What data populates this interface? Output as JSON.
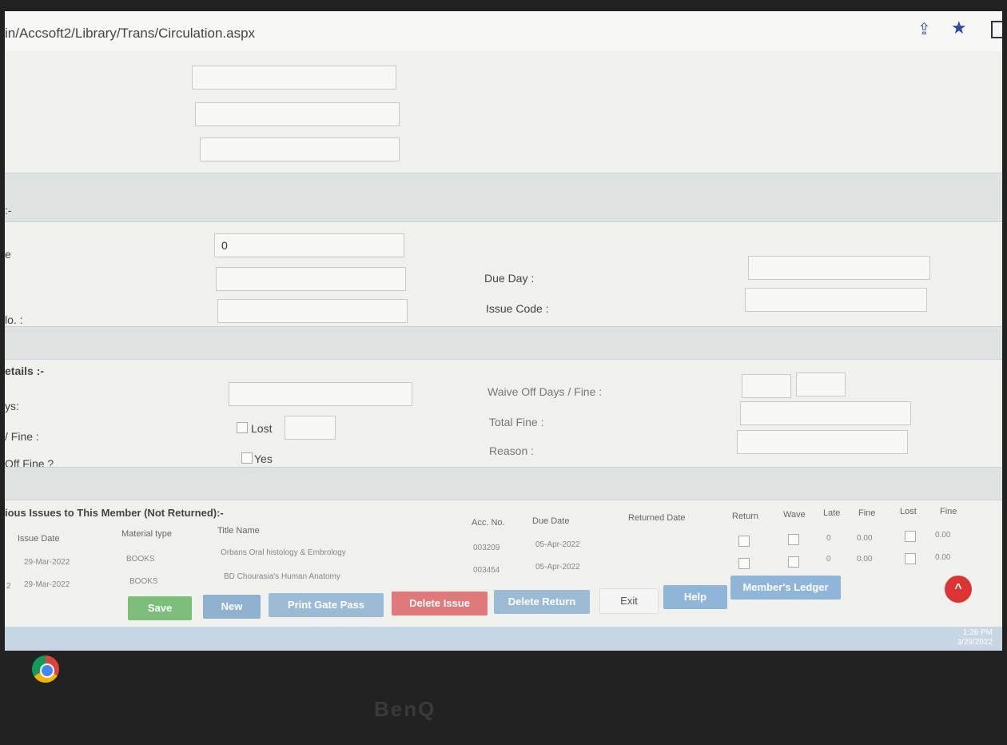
{
  "browser": {
    "url": "in/Accsoft2/Library/Trans/Circulation.aspx",
    "share_icon": "share-icon",
    "star_icon": "star-icon"
  },
  "section1": {
    "header": ":-",
    "field_a_label": "e",
    "field_a_value": "0",
    "field_c_label": "lo. :",
    "due_day_label": "Due Day :",
    "issue_code_label": "Issue Code :"
  },
  "section2": {
    "header": "etails :-",
    "row1_label": "ys:",
    "row2_label": "/ Fine :",
    "row3_label": "Off Fine ?",
    "lost_label": "Lost",
    "yes_label": "Yes",
    "waive_label": "Waive Off Days / Fine :",
    "total_fine_label": "Total Fine :",
    "reason_label": "Reason :"
  },
  "previous": {
    "title": "ious Issues to This Member (Not Returned):-",
    "headers": [
      "Issue Date",
      "Material type",
      "Title Name",
      "Acc. No.",
      "Due Date",
      "Returned Date",
      "Return",
      "Wave",
      "Late",
      "Fine",
      "Lost",
      "Fine"
    ],
    "rows": [
      {
        "num": "",
        "issue_date": "29-Mar-2022",
        "material": "BOOKS",
        "title": "Orbans Oral histology & Embrology",
        "acc_no": "003209",
        "due": "05-Apr-2022",
        "late": "0",
        "fine": "0.00",
        "lost_fine": "0.00"
      },
      {
        "num": "2",
        "issue_date": "29-Mar-2022",
        "material": "BOOKS",
        "title": "BD Chourasia's Human Anatomy",
        "acc_no": "003454",
        "due": "05-Apr-2022",
        "late": "0",
        "fine": "0.00",
        "lost_fine": "0.00"
      }
    ]
  },
  "buttons": {
    "save": "Save",
    "new": "New",
    "print_gate_pass": "Print Gate Pass",
    "delete_issue": "Delete Issue",
    "delete_return": "Delete Return",
    "exit": "Exit",
    "help": "Help",
    "ledger": "Member's Ledger"
  },
  "taskbar": {
    "time": "1:28 PM",
    "date": "3/29/2022"
  },
  "monitor": {
    "brand": "BenQ"
  }
}
